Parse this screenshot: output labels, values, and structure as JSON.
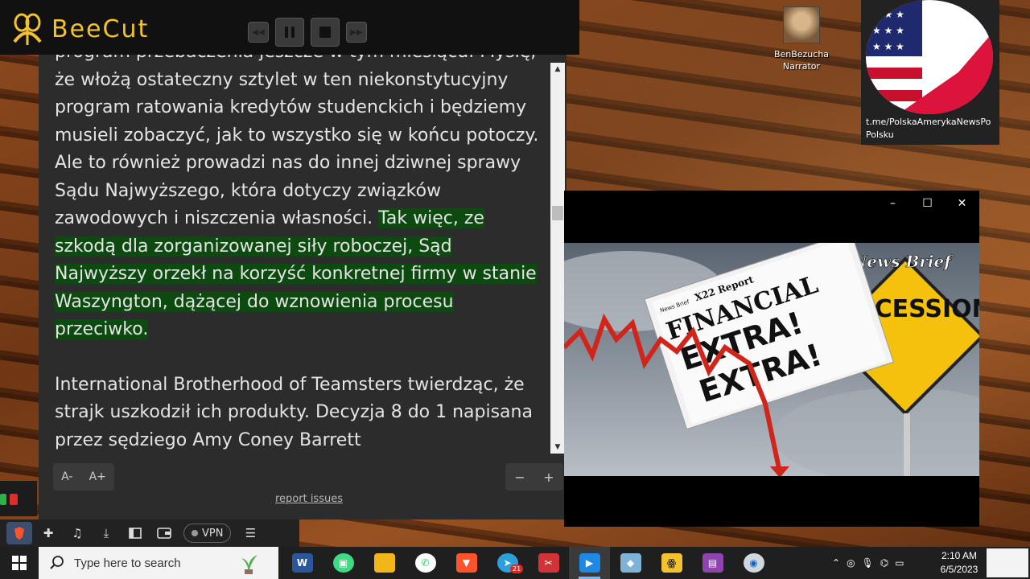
{
  "beecut": {
    "brand": "BeeCut",
    "controls": [
      "rewind",
      "pause",
      "stop",
      "forward"
    ]
  },
  "reader": {
    "paragraph1_plain": "program przebaczenia jeszcze w tym miesiącu. Myślę, że włożą ostateczny sztylet w ten niekonstytucyjny program ratowania kredytów studenckich i będziemy musieli zobaczyć, jak to wszystko się w końcu potoczy. Ale to również prowadzi nas do innej dziwnej sprawy Sądu Najwyższego, która dotyczy związków zawodowych i niszczenia własności.",
    "paragraph1_highlight": "Tak więc, ze szkodą dla zorganizowanej siły roboczej, Sąd Najwyższy orzekł na korzyść konkretnej firmy w stanie Waszyngton, dążącej do wznowienia procesu przeciwko.",
    "paragraph2": "International Brotherhood of Teamsters twierdząc, że strajk uszkodził ich produkty. Decyzja 8 do 1 napisana przez sędziego Amy Coney Barrett",
    "font_decrease": "A-",
    "font_increase": "A+",
    "zoom_out": "−",
    "zoom_in": "+",
    "report_link": "report issues",
    "highlight_color": "#0d4a10"
  },
  "browser_toolbar": {
    "vpn_label": "VPN",
    "icons": [
      "brave-icon",
      "extensions-icon",
      "playlist-icon",
      "download-icon",
      "sidebar-icon",
      "wallet-icon",
      "menu-icon"
    ]
  },
  "narrator": {
    "name": "BenBezucha",
    "role": "Narrator"
  },
  "channel": {
    "link": "t.me/PolskaAmerykaNewsPo Polsku"
  },
  "video": {
    "banner": "News Brief",
    "sign": "RECESSION",
    "paper_masthead": "X22 Report",
    "paper_tag": "News Brief",
    "paper_headline": "FINANCIAL",
    "paper_extra": "EXTRA!",
    "window_controls": [
      "–",
      "☐",
      "✕"
    ]
  },
  "taskbar": {
    "search_placeholder": "Type here to search",
    "telegram_badge": "21",
    "time": "2:10 AM",
    "date": "6/5/2023",
    "active_app": "video-player"
  }
}
